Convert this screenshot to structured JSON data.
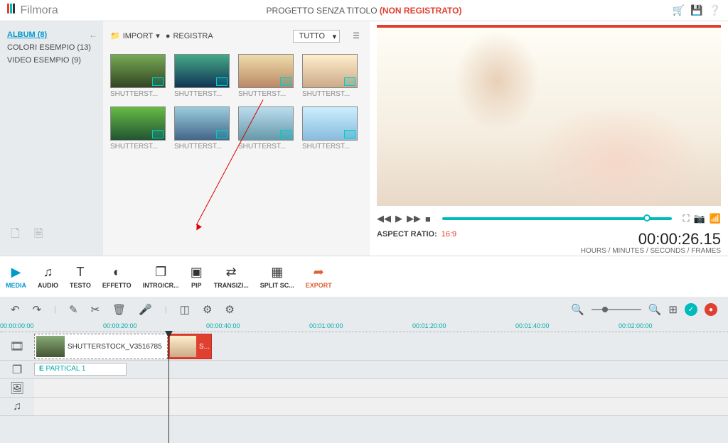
{
  "logo": "Filmora",
  "title": {
    "text": "PROGETTO SENZA TITOLO",
    "unsaved": "(NON REGISTRATO)"
  },
  "sidebar": {
    "items": [
      {
        "label": "ALBUM (8)",
        "active": true
      },
      {
        "label": "COLORI ESEMPIO (13)"
      },
      {
        "label": "VIDEO ESEMPIO (9)"
      }
    ]
  },
  "library": {
    "import": "IMPORT",
    "record": "REGISTRA",
    "filter": "TUTTO",
    "thumbs": [
      {
        "label": "SHUTTERST..."
      },
      {
        "label": "SHUTTERST..."
      },
      {
        "label": "SHUTTERST..."
      },
      {
        "label": "SHUTTERST..."
      },
      {
        "label": "SHUTTERST..."
      },
      {
        "label": "SHUTTERST..."
      },
      {
        "label": "SHUTTERST..."
      },
      {
        "label": "SHUTTERST..."
      }
    ]
  },
  "preview": {
    "aspect_label": "ASPECT RATIO:",
    "aspect_value": "16:9",
    "timecode": "00:00:26.15",
    "timecode_label": "HOURS / MINUTES / SECONDS / FRAMES"
  },
  "tabs": [
    {
      "label": "MEDIA",
      "icon": "▶",
      "active": true
    },
    {
      "label": "AUDIO",
      "icon": "♫"
    },
    {
      "label": "TESTO",
      "icon": "T"
    },
    {
      "label": "EFFETTO",
      "icon": "◐"
    },
    {
      "label": "INTRO/CR...",
      "icon": "❐"
    },
    {
      "label": "PIP",
      "icon": "▣"
    },
    {
      "label": "TRANSIZI...",
      "icon": "⇄"
    },
    {
      "label": "SPLIT SC...",
      "icon": "▦"
    },
    {
      "label": "EXPORT",
      "icon": "➦",
      "export": true
    }
  ],
  "ruler": [
    "00:00:00:00",
    "00:00:20:00",
    "00:00:40:00",
    "00:01:00:00",
    "00:01:20:00",
    "00:01:40:00",
    "00:02:00:00"
  ],
  "clips": {
    "video": {
      "label": "SHUTTERSTOCK_V3516785"
    },
    "selected": {
      "label": "S..."
    },
    "pip": {
      "label": "PARTICAL 1"
    }
  }
}
